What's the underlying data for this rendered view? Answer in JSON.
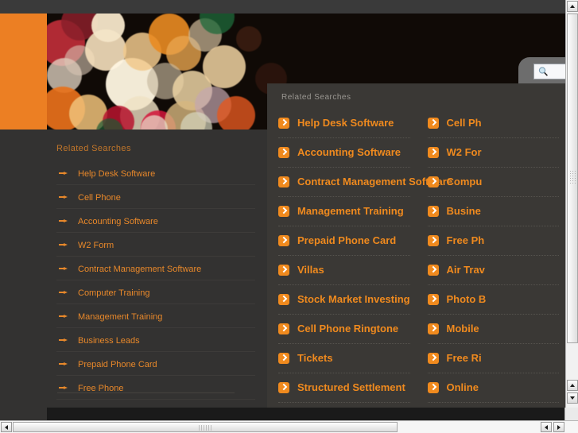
{
  "colors": {
    "brand_orange": "#ec7f23",
    "link_orange": "#e8882a",
    "overlay_link_orange": "#f08a1e",
    "page_bg": "#333231",
    "overlay_bg": "#3a3835",
    "header_gray": "#9a9792"
  },
  "hero": {
    "alt": "bokeh-lights-photo"
  },
  "search": {
    "icon": "search-icon",
    "value": "",
    "placeholder": ""
  },
  "left_panel": {
    "heading": "Related Searches",
    "items": [
      {
        "label": "Help Desk Software"
      },
      {
        "label": "Cell Phone"
      },
      {
        "label": "Accounting Software"
      },
      {
        "label": "W2 Form"
      },
      {
        "label": "Contract Management Software"
      },
      {
        "label": "Computer Training"
      },
      {
        "label": "Management Training"
      },
      {
        "label": "Business Leads"
      },
      {
        "label": "Prepaid Phone Card"
      },
      {
        "label": "Free Phone"
      }
    ]
  },
  "overlay": {
    "heading": "Related Searches",
    "left_column": [
      {
        "label": "Help Desk Software"
      },
      {
        "label": "Accounting Software"
      },
      {
        "label": "Contract Management Software"
      },
      {
        "label": "Management Training"
      },
      {
        "label": "Prepaid Phone Card"
      },
      {
        "label": "Villas"
      },
      {
        "label": "Stock Market Investing"
      },
      {
        "label": "Cell Phone Ringtone"
      },
      {
        "label": "Tickets"
      },
      {
        "label": "Structured Settlement"
      }
    ],
    "right_column": [
      {
        "label": "Cell Ph"
      },
      {
        "label": "W2 For"
      },
      {
        "label": "Compu"
      },
      {
        "label": "Busine"
      },
      {
        "label": "Free Ph"
      },
      {
        "label": "Air Trav"
      },
      {
        "label": "Photo B"
      },
      {
        "label": "Mobile"
      },
      {
        "label": "Free Ri"
      },
      {
        "label": "Online "
      }
    ]
  },
  "scrollbars": {
    "vertical": {
      "up": "scroll-up-arrow",
      "down": "scroll-down-arrow"
    },
    "horizontal": {
      "left": "scroll-left-arrow",
      "right": "scroll-right-arrow"
    }
  }
}
